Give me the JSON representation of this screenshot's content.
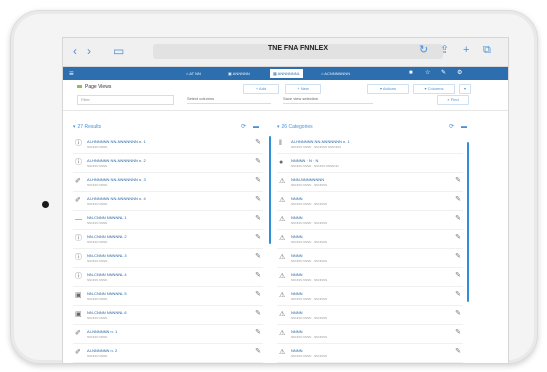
{
  "browser": {
    "back": "‹",
    "forward": "›",
    "bookmarks": "▭",
    "url": "TNE FNA FNNLEX",
    "reload": "↻",
    "share": "⇪",
    "new_tab": "+",
    "tabs": "⧉"
  },
  "appbar": {
    "menu": "≡",
    "tabs": [
      {
        "label": "⌂ AT NN",
        "active": false
      },
      {
        "label": "▣ ANNNNN",
        "active": false
      },
      {
        "label": "▦ ANNNNNNL",
        "active": true
      },
      {
        "label": "⌂ ACNNNNNNN",
        "active": false
      }
    ],
    "icons": [
      "■",
      "☆",
      "✎",
      "⚙"
    ]
  },
  "toolbar": {
    "title": "Page Views",
    "search_placeholder": "Filter",
    "btn_a": "+ Add",
    "btn_b": "+ New",
    "select_a": "Select columns",
    "select_b": "Save view selection",
    "btn_c": "▾ Actions",
    "btn_d": "▾ Columns",
    "btn_e": "⌕ Find"
  },
  "left_panel": {
    "heading": "27 Results",
    "rows": [
      {
        "icon": "ⓘ",
        "title": "AI-HNNNNN NN-NNNNNNN n. 1",
        "sub": "NNNNN NNNN",
        "action": "✎"
      },
      {
        "icon": "ⓘ",
        "title": "AI-HNNNNN NN-NNNNNNN n. 2",
        "sub": "NNNNN NNNN",
        "action": "✎"
      },
      {
        "icon": "✐",
        "title": "AI-HNNNNN NN-NNNNNNN n. 3",
        "sub": "NNNNN NNNN",
        "action": "✎"
      },
      {
        "icon": "✐",
        "title": "AI-HNNNNN NN-NNNNNNN n. 4",
        "sub": "NNNNN NNNN",
        "action": "✎"
      },
      {
        "icon": "—",
        "title": "NN-CNNN NNNNNL 1",
        "sub": "NNNNN NNNN",
        "action": "✎"
      },
      {
        "icon": "ⓘ",
        "title": "NN-CNNN NNNNNL 2",
        "sub": "NNNNN NNNN",
        "action": "✎"
      },
      {
        "icon": "ⓘ",
        "title": "NN-CNNN NNNNNL 3",
        "sub": "NNNNN NNNN",
        "action": "✎"
      },
      {
        "icon": "ⓘ",
        "title": "NN-CNNN NNNNNL 4",
        "sub": "NNNNN NNNN",
        "action": "✎"
      },
      {
        "icon": "▣",
        "title": "NN-CNNN NNNNNL 5",
        "sub": "NNNNN NNNN",
        "action": "✎"
      },
      {
        "icon": "▣",
        "title": "NN-CNNN NNNNNL 6",
        "sub": "NNNNN NNNN",
        "action": "✎"
      },
      {
        "icon": "✐",
        "title": "AI-NNNNNN n. 1",
        "sub": "NNNNN NNNN",
        "action": "✎"
      },
      {
        "icon": "✐",
        "title": "AI-NNNNNN n. 2",
        "sub": "NNNNN NNNN",
        "action": "✎"
      }
    ]
  },
  "right_panel": {
    "heading": "26 Categories",
    "rows": [
      {
        "icon": "‖",
        "title": "AI-HNNNNN NN-NNNNNNN n. 1",
        "sub": "NNNNN NNNN · NNNNNN NNNNNN",
        "action": ""
      },
      {
        "icon": "●",
        "title": "NNNNN · N · N",
        "sub": "NNNNN NNNN · NNNNN NNNNNN",
        "action": ""
      },
      {
        "icon": "⚠",
        "title": "NNN-NNNNNNNN",
        "sub": "NNNNN NNNN · NNNNNN",
        "action": "✎"
      },
      {
        "icon": "⚠",
        "title": "NNNN",
        "sub": "NNNNN NNNN · NNNNNN",
        "action": "✎"
      },
      {
        "icon": "⚠",
        "title": "NNNN",
        "sub": "NNNNN NNNN · NNNNNN",
        "action": "✎"
      },
      {
        "icon": "⚠",
        "title": "NNNN",
        "sub": "NNNNN NNNN · NNNNNN",
        "action": "✎"
      },
      {
        "icon": "⚠",
        "title": "NNNN",
        "sub": "NNNNN NNNN · NNNNNN",
        "action": "✎"
      },
      {
        "icon": "⚠",
        "title": "NNNN",
        "sub": "NNNNN NNNN · NNNNNN",
        "action": "✎"
      },
      {
        "icon": "⚠",
        "title": "NNNN",
        "sub": "NNNNN NNNN · NNNNNN",
        "action": "✎"
      },
      {
        "icon": "⚠",
        "title": "NNNN",
        "sub": "NNNNN NNNN · NNNNNN",
        "action": "✎"
      },
      {
        "icon": "⚠",
        "title": "NNNN",
        "sub": "NNNNN NNNN · NNNNNN",
        "action": "✎"
      },
      {
        "icon": "⚠",
        "title": "NNNN",
        "sub": "NNNNN NNNN · NNNNNN",
        "action": "✎"
      }
    ]
  },
  "panel_tools": {
    "refresh": "⟳",
    "collapse": "▬"
  },
  "colors": {
    "accent": "#2d6fae",
    "link": "#4a90d9",
    "brand_green": "#8bc34a"
  }
}
